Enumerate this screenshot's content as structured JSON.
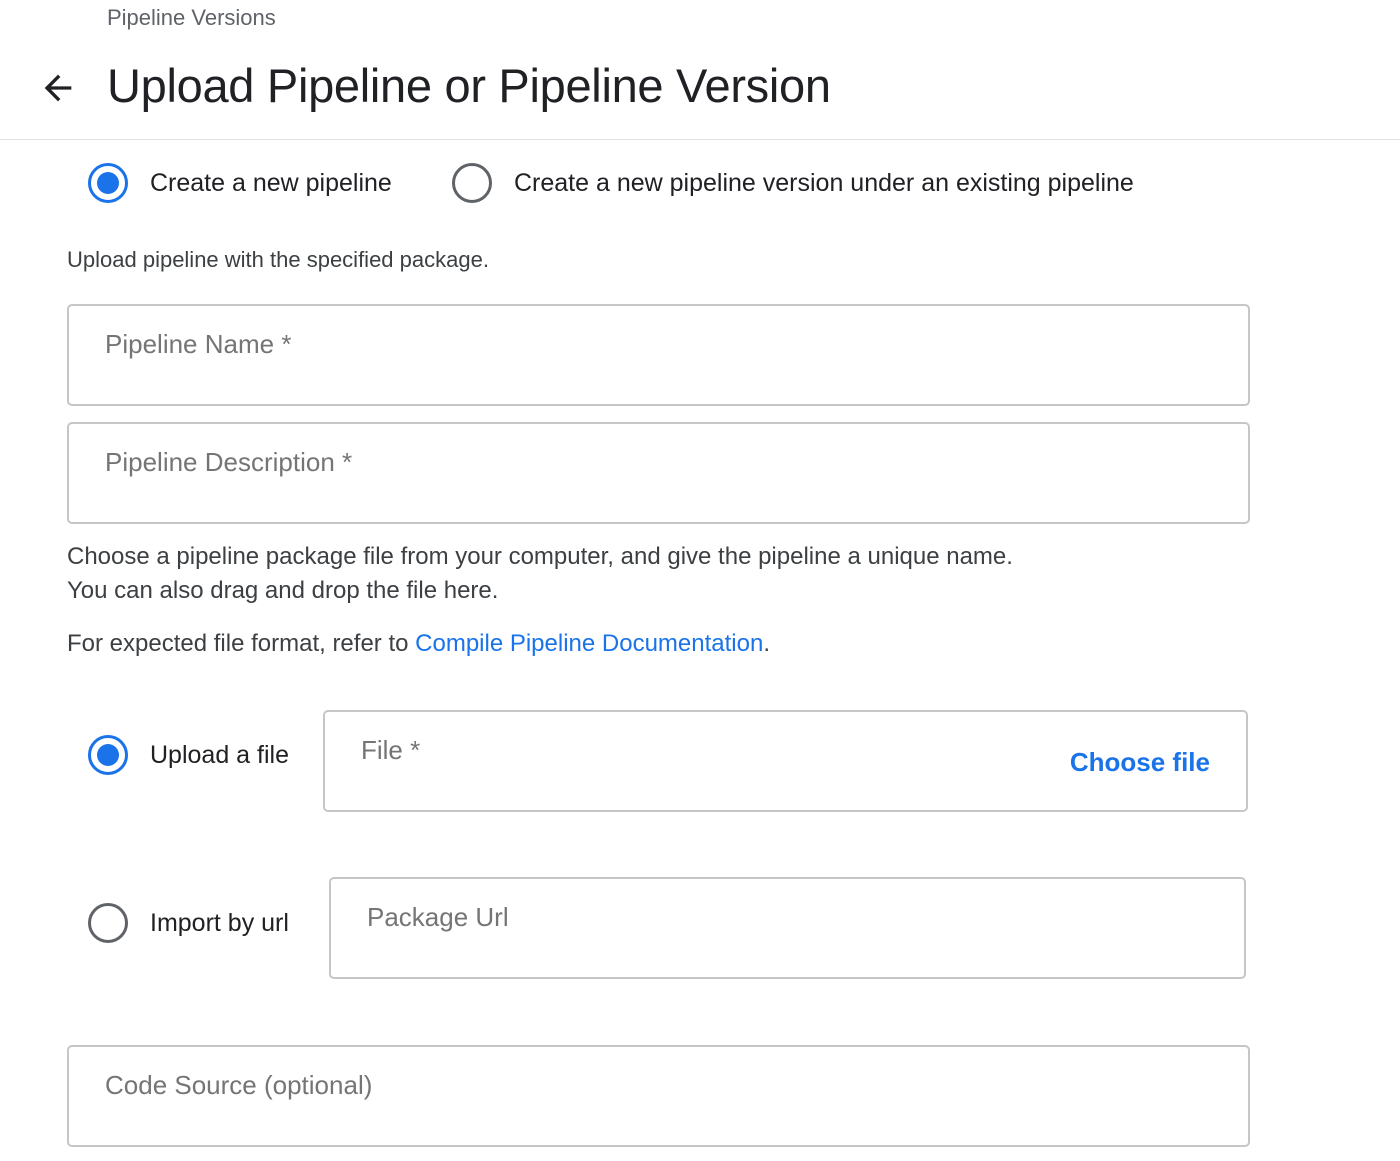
{
  "header": {
    "breadcrumb": "Pipeline Versions",
    "title": "Upload Pipeline or Pipeline Version",
    "back_icon": "arrow-back-icon"
  },
  "mode_options": [
    {
      "label": "Create a new pipeline",
      "checked": true
    },
    {
      "label": "Create a new pipeline version under an existing pipeline",
      "checked": false
    }
  ],
  "intro_text": "Upload pipeline with the specified package.",
  "fields": {
    "pipeline_name": {
      "placeholder": "Pipeline Name *",
      "value": ""
    },
    "pipeline_description": {
      "placeholder": "Pipeline Description *",
      "value": ""
    },
    "package_url": {
      "placeholder": "Package Url",
      "value": ""
    },
    "code_source": {
      "placeholder": "Code Source (optional)",
      "value": ""
    }
  },
  "instructions": {
    "line1": "Choose a pipeline package file from your computer, and give the pipeline a unique name.",
    "line2": "You can also drag and drop the file here.",
    "format_prefix": "For expected file format, refer to ",
    "format_link": "Compile Pipeline Documentation",
    "format_suffix": "."
  },
  "source_options": {
    "upload": {
      "label": "Upload a file",
      "checked": true
    },
    "url": {
      "label": "Import by url",
      "checked": false
    }
  },
  "file_field": {
    "label": "File *",
    "choose_button": "Choose file"
  },
  "colors": {
    "accent": "#1a73e8",
    "border": "#c4c7c5",
    "text": "#202124",
    "muted": "#757575"
  }
}
